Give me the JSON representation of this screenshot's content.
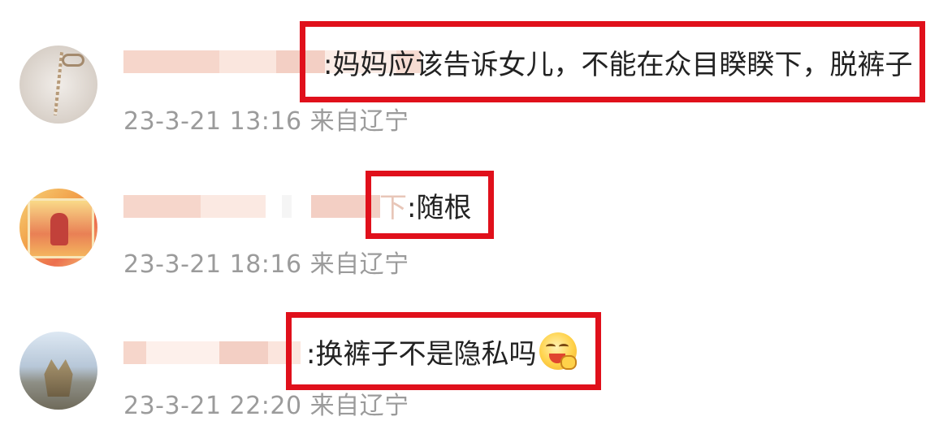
{
  "comments": [
    {
      "name_trail": "",
      "text": ":妈妈应该告诉女儿，不能在众目睽睽下，脱裤子",
      "timestamp": "23-3-21 13:16 来自辽宁"
    },
    {
      "name_trail": "下",
      "text": ":随根",
      "timestamp": "23-3-21 18:16 来自辽宁"
    },
    {
      "name_trail": "",
      "text": ":换裤子不是隐私吗",
      "emoji": "grinning-face-with-hand-emoji",
      "timestamp": "23-3-21 22:20 来自辽宁"
    }
  ],
  "colors": {
    "highlight_border": "#e0101b",
    "text": "#222222",
    "timestamp": "#9b9b9b",
    "blur_name": "#f3cfc4"
  }
}
